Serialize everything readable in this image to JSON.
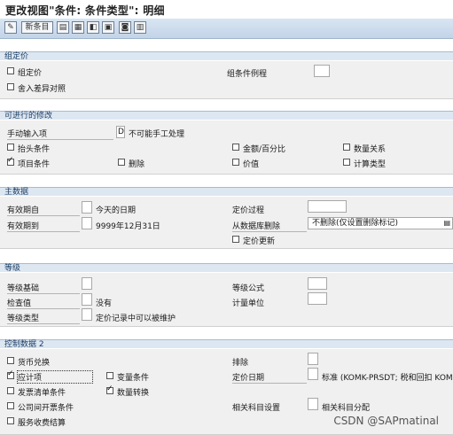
{
  "title": "更改视图\"条件: 条件类型\": 明细",
  "toolbar": {
    "new_entries": "新条目"
  },
  "sections": {
    "group_price": {
      "header": "组定价",
      "group_price_cb": "组定价",
      "group_cond_routine": "组条件例程",
      "include_diff": "舍入差异对照"
    },
    "changes": {
      "header": "可进行的修改",
      "manual_entry": "手动输入项",
      "manual_entry_value": "D",
      "manual_entry_text": "不可能手工处理",
      "header_cond": "抬头条件",
      "amount_pct": "金额/百分比",
      "qty_rel": "数量关系",
      "item_cond": "项目条件",
      "delete": "删除",
      "value": "价值",
      "calc_type": "计算类型"
    },
    "master": {
      "header": "主数据",
      "valid_from": "有效期自",
      "valid_from_text": "今天的日期",
      "valid_to": "有效期到",
      "valid_to_text": "9999年12月31日",
      "pricing_proc": "定价过程",
      "delete_db": "从数据库删除",
      "delete_db_value": "不删除(仅设置删除标记)",
      "price_update": "定价更新"
    },
    "scales": {
      "header": "等级",
      "scale_basis": "等级基础",
      "check_value": "检查值",
      "check_value_text": "没有",
      "scale_type": "等级类型",
      "scale_type_text": "定价记录中可以被维护",
      "scale_formula": "等级公式",
      "unit": "计量单位"
    },
    "control": {
      "header": "控制数据 2",
      "currency_conv": "货币兑换",
      "exclusion": "排除",
      "accrual": "应计项",
      "variant_cond": "变量条件",
      "pricing_date": "定价日期",
      "pricing_date_text": "标准 (KOMK-PRSDT; 税和回扣 KOM",
      "invoice_list": "发票清单条件",
      "qty_conv": "数量转换",
      "interco": "公司间开票条件",
      "acct_settings": "相关科目设置",
      "acct_assign": "相关科目分配",
      "service_settle": "服务收费结算"
    }
  },
  "watermark": "CSDN @SAPmatinal",
  "colors": {
    "band": "#dde7f2",
    "band_text": "#1c3f66",
    "panel": "#f0f0f0",
    "toolbar": "#c3d4e8"
  }
}
